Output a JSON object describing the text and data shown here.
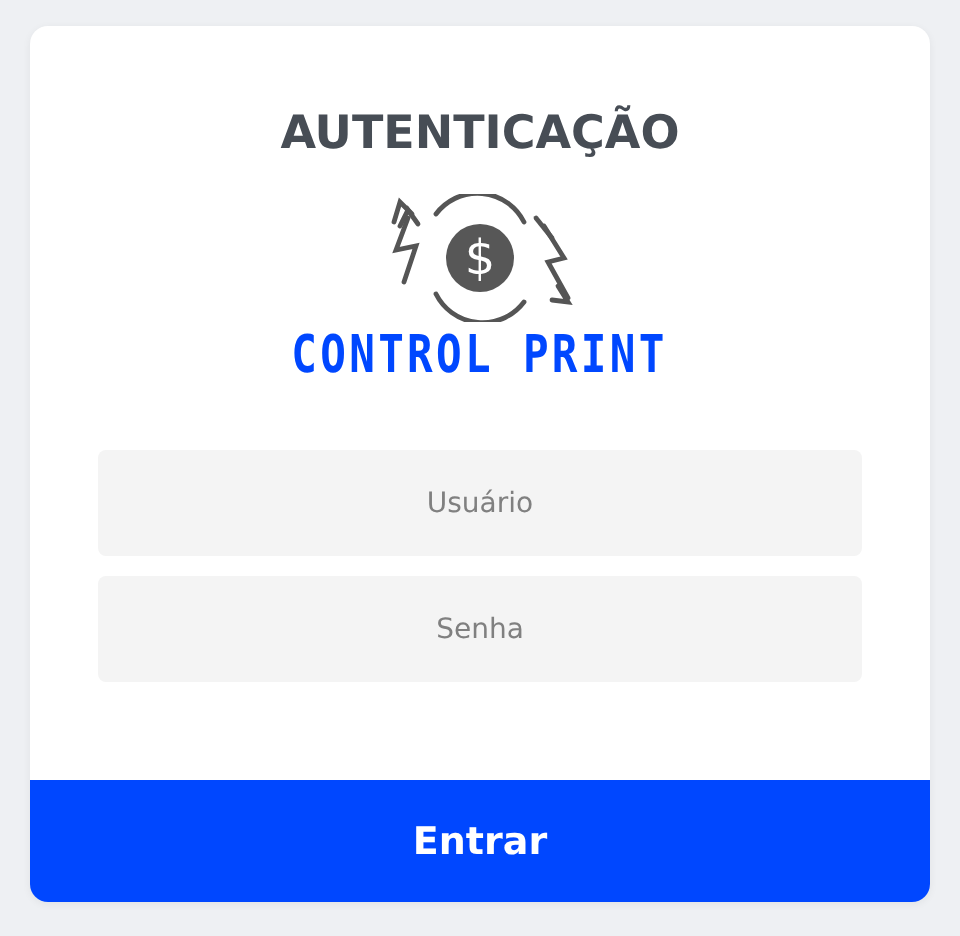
{
  "title": "AUTENTICAÇÃO",
  "logo": {
    "symbol": "$",
    "name": "CONTROL PRINT"
  },
  "fields": [
    {
      "placeholder": "Usuário"
    },
    {
      "placeholder": "Senha"
    }
  ],
  "button": "Entrar"
}
